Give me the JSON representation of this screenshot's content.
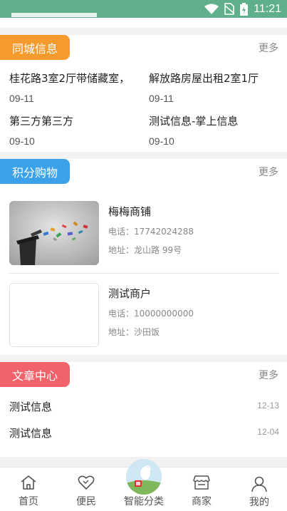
{
  "status_bar": {
    "time": "11:21"
  },
  "city_info": {
    "tag": "同城信息",
    "more": "更多",
    "items": [
      {
        "title": "桂花路3室2厅带储藏室，",
        "date": "09-11"
      },
      {
        "title": "解放路房屋出租2室1厅",
        "date": "09-11"
      },
      {
        "title": "第三方第三方",
        "date": "09-10"
      },
      {
        "title": "测试信息-掌上信息",
        "date": "09-10"
      }
    ]
  },
  "points_shop": {
    "tag": "积分购物",
    "more": "更多",
    "shops": [
      {
        "name": "梅梅商铺",
        "phone": "电话：17742024288",
        "address": "地址：龙山路 99号"
      },
      {
        "name": "测试商户",
        "phone": "电话：10000000000",
        "address": "地址：沙田饭"
      }
    ]
  },
  "articles": {
    "tag": "文章中心",
    "more": "更多",
    "items": [
      {
        "title": "测试信息",
        "date": "12-13"
      },
      {
        "title": "测试信息",
        "date": "12-04"
      }
    ]
  },
  "tabbar": {
    "tabs": [
      {
        "label": "首页",
        "icon": "home-icon"
      },
      {
        "label": "便民",
        "icon": "heart-icon"
      },
      {
        "label": "智能分类",
        "icon": "sort-logo-icon"
      },
      {
        "label": "商家",
        "icon": "shop-icon"
      },
      {
        "label": "我的",
        "icon": "user-icon"
      }
    ]
  },
  "colors": {
    "status_bar": "#5fb08a",
    "city_tag": "#f79a2d",
    "shop_tag": "#3ba2ea",
    "article_tag": "#f2626b"
  }
}
